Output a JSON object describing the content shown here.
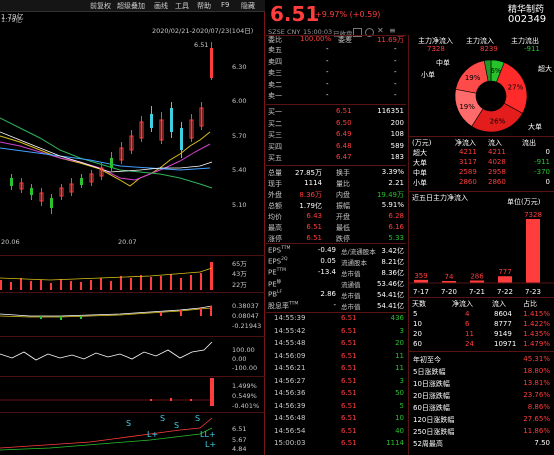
{
  "toolbar": {
    "buttons": [
      "前复权",
      "超级叠加",
      "画线",
      "工具",
      "帮助",
      "F9",
      "隐藏"
    ],
    "back_button": "↑",
    "level_label": "1.79亿"
  },
  "chart_header": {
    "date_range": "2020/02/21-2020/07/23(104日)"
  },
  "price_axis": [
    "6.30",
    "6.00",
    "5.70",
    "5.40",
    "5.10"
  ],
  "peak_label": "6.51",
  "date_axis": [
    "20.06",
    "20.07"
  ],
  "volume_axis": [
    "65万",
    "43万",
    "22万"
  ],
  "indicator1_axis": [
    "0.38037",
    "0.08047",
    "-0.21943"
  ],
  "indicator2_axis": [
    "100.00",
    "0.00",
    "-100.00"
  ],
  "indicator3_axis": [
    "1.499%",
    "0.549%",
    "-0.401%"
  ],
  "indicator4_axis": [
    "6.51",
    "5.67",
    "4.84"
  ],
  "signals": [
    "S",
    "S",
    "L+",
    "S",
    "S",
    "LL+",
    "L+"
  ],
  "quote": {
    "price": "6.51",
    "change": "+9.97% (+0.59)",
    "name": "精华制药",
    "code": "002349"
  },
  "status_line": {
    "tabs": [
      "SZSE",
      "CNY",
      "15:00:03",
      "已收盘"
    ],
    "icons": [
      "grid-icon",
      "compare-icon",
      "close-icon",
      "menu-icon"
    ]
  },
  "order_book": {
    "header": {
      "label": "委比",
      "ratio": "100.00%",
      "diff_label": "委差",
      "diff": "11.69万"
    },
    "asks": [
      {
        "label": "卖五",
        "price": "-",
        "vol": "-"
      },
      {
        "label": "卖四",
        "price": "-",
        "vol": "-"
      },
      {
        "label": "卖三",
        "price": "-",
        "vol": "-"
      },
      {
        "label": "卖二",
        "price": "-",
        "vol": "-"
      },
      {
        "label": "卖一",
        "price": "-",
        "vol": "-"
      }
    ],
    "bids": [
      {
        "label": "买一",
        "price": "6.51",
        "vol": "116351"
      },
      {
        "label": "买二",
        "price": "6.50",
        "vol": "200"
      },
      {
        "label": "买三",
        "price": "6.49",
        "vol": "108"
      },
      {
        "label": "买四",
        "price": "6.48",
        "vol": "589"
      },
      {
        "label": "买五",
        "price": "6.47",
        "vol": "183"
      }
    ]
  },
  "stats": [
    {
      "l1": "总量",
      "v1": "27.85万",
      "l2": "换手",
      "v2": "3.39%",
      "c1": "white",
      "c2": "white"
    },
    {
      "l1": "现手",
      "v1": "1114",
      "l2": "量比",
      "v2": "2.21",
      "c1": "white",
      "c2": "white"
    },
    {
      "l1": "外盘",
      "v1": "8.36万",
      "l2": "内盘",
      "v2": "19.49万",
      "c1": "red",
      "c2": "green"
    },
    {
      "l1": "总额",
      "v1": "1.79亿",
      "l2": "振幅",
      "v2": "5.91%",
      "c1": "white",
      "c2": "white"
    },
    {
      "l1": "均价",
      "v1": "6.43",
      "l2": "开盘",
      "v2": "6.28",
      "c1": "red",
      "c2": "red"
    },
    {
      "l1": "最高",
      "v1": "6.51",
      "l2": "最低",
      "v2": "6.16",
      "c1": "red",
      "c2": "red"
    },
    {
      "l1": "涨停",
      "v1": "6.51",
      "l2": "跌停",
      "v2": "5.33",
      "c1": "red",
      "c2": "green"
    }
  ],
  "fundamentals": [
    {
      "l1": "EPS",
      "s1": "TTM",
      "v1": "-0.49",
      "l2": "总/流通股本",
      "v2": "3.42亿"
    },
    {
      "l1": "EPS",
      "s1": "2Q",
      "v1": "0.05",
      "l2": "流通股本",
      "v2": "8.21亿"
    },
    {
      "l1": "PE",
      "s1": "TTM",
      "v1": "-13.4",
      "l2": "总市值",
      "v2": "8.36亿"
    },
    {
      "l1": "PE",
      "s1": "静",
      "v1": "",
      "l2": "流通值",
      "v2": "53.46亿"
    },
    {
      "l1": "PB",
      "s1": "LF",
      "v1": "2.86",
      "l2": "总市值",
      "v2": "54.41亿"
    },
    {
      "l1": "股息率",
      "s1": "TTM",
      "v1": "-",
      "l2": "总市值",
      "v2": "54.41亿"
    }
  ],
  "ticks": [
    {
      "time": "14:55:39",
      "price": "6.51",
      "vol": "436",
      "c": "green"
    },
    {
      "time": "14:55:42",
      "price": "6.51",
      "vol": "3",
      "c": "green"
    },
    {
      "time": "14:55:48",
      "price": "6.51",
      "vol": "20",
      "c": "green"
    },
    {
      "time": "14:56:09",
      "price": "6.51",
      "vol": "11",
      "c": "green"
    },
    {
      "time": "14:56:21",
      "price": "6.51",
      "vol": "11",
      "c": "green"
    },
    {
      "time": "14:56:27",
      "price": "6.51",
      "vol": "3",
      "c": "green"
    },
    {
      "time": "14:56:36",
      "price": "6.51",
      "vol": "50",
      "c": "green"
    },
    {
      "time": "14:56:39",
      "price": "6.51",
      "vol": "5",
      "c": "green"
    },
    {
      "time": "14:56:48",
      "price": "6.51",
      "vol": "10",
      "c": "green"
    },
    {
      "time": "14:56:54",
      "price": "6.51",
      "vol": "40",
      "c": "green"
    },
    {
      "time": "15:00:03",
      "price": "6.51",
      "vol": "1114",
      "c": "green"
    }
  ],
  "capital_flow": {
    "headers": [
      "主力净流入",
      "主力流入",
      "主力流出"
    ],
    "values": [
      "7328",
      "8239",
      "-911"
    ],
    "donut_segments": [
      {
        "label": "中单",
        "pct": "6%",
        "color": "#27c22c",
        "value": 6
      },
      {
        "label": "超大",
        "pct": "27%",
        "color": "#ff2a2a",
        "value": 27
      },
      {
        "label": "大单",
        "pct": "26%",
        "color": "#e31c1c",
        "value": 26
      },
      {
        "label": "小单",
        "pct": "19%",
        "color": "#ff6b6b",
        "value": 19
      },
      {
        "label": "",
        "pct": "19%",
        "color": "#ff4a4a",
        "value": 19
      },
      {
        "label": "",
        "pct": "",
        "color": "#1f9a24",
        "value": 3
      }
    ],
    "table_header": [
      "(万元)",
      "净流入",
      "流入",
      "流出"
    ],
    "rows": [
      {
        "label": "超大",
        "net": "4211",
        "in": "4211",
        "out": "0"
      },
      {
        "label": "大单",
        "net": "3117",
        "in": "4028",
        "out": "-911"
      },
      {
        "label": "中单",
        "net": "2589",
        "in": "2958",
        "out": "-370"
      },
      {
        "label": "小单",
        "net": "2860",
        "in": "2860",
        "out": "0"
      }
    ]
  },
  "bar_chart": {
    "title": "近五日主力净流入",
    "unit_label": "单位(万元)",
    "categories": [
      "7-17",
      "7-20",
      "7-21",
      "7-22",
      "7-23"
    ],
    "values": [
      359,
      74,
      286,
      777,
      7328
    ]
  },
  "period_table": {
    "headers": [
      "天数",
      "净流入",
      "流入",
      "占比"
    ],
    "rows": [
      {
        "days": "5",
        "net": "4",
        "in": "8604",
        "pct": "1.415%"
      },
      {
        "days": "10",
        "net": "6",
        "in": "8777",
        "pct": "1.422%"
      },
      {
        "days": "20",
        "net": "11",
        "in": "9149",
        "pct": "1.435%"
      },
      {
        "days": "60",
        "net": "24",
        "in": "10971",
        "pct": "1.479%"
      }
    ]
  },
  "performance": [
    {
      "label": "年初至今",
      "value": "45.31%"
    },
    {
      "label": "5日涨跌幅",
      "value": "18.80%"
    },
    {
      "label": "10日涨跌幅",
      "value": "13.81%"
    },
    {
      "label": "20日涨跌幅",
      "value": "23.76%"
    },
    {
      "label": "60日涨跌幅",
      "value": "8.86%"
    },
    {
      "label": "120日涨跌幅",
      "value": "27.65%"
    },
    {
      "label": "250日涨跌幅",
      "value": "11.86%"
    },
    {
      "label": "52周最高",
      "value": "7.50"
    }
  ]
}
